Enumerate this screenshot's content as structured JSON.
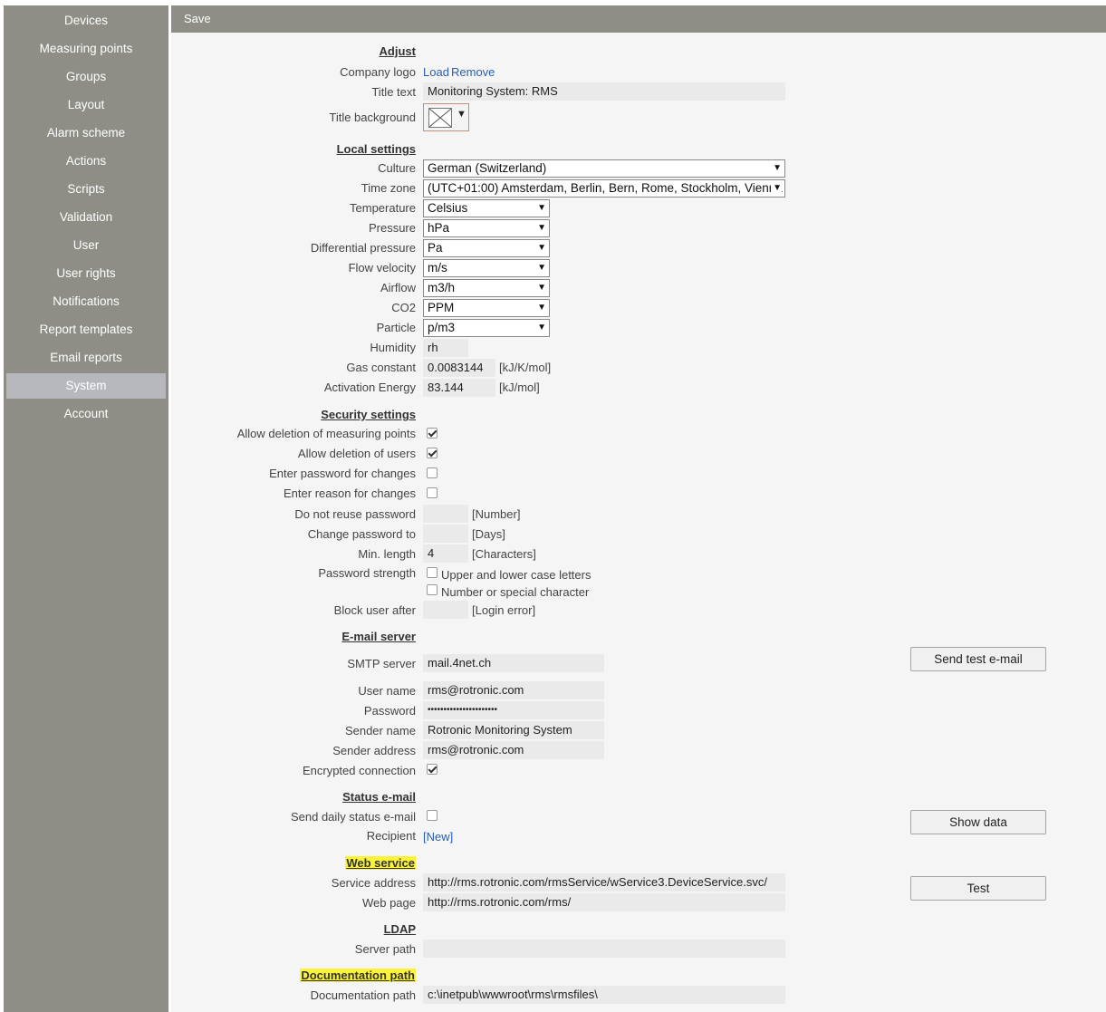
{
  "sidebar": {
    "items": [
      {
        "label": "Devices"
      },
      {
        "label": "Measuring points"
      },
      {
        "label": "Groups"
      },
      {
        "label": "Layout"
      },
      {
        "label": "Alarm scheme"
      },
      {
        "label": "Actions"
      },
      {
        "label": "Scripts"
      },
      {
        "label": "Validation"
      },
      {
        "label": "User"
      },
      {
        "label": "User rights"
      },
      {
        "label": "Notifications"
      },
      {
        "label": "Report templates"
      },
      {
        "label": "Email reports"
      },
      {
        "label": "System"
      },
      {
        "label": "Account"
      }
    ],
    "active": "System"
  },
  "toolbar": {
    "save_label": "Save"
  },
  "adjust": {
    "heading": "Adjust",
    "company_logo_label": "Company logo",
    "load_link": "Load",
    "remove_link": "Remove",
    "title_text_label": "Title text",
    "title_text_value": "Monitoring System: RMS",
    "title_background_label": "Title background"
  },
  "local": {
    "heading": "Local settings",
    "culture_label": "Culture",
    "culture_value": "German (Switzerland)",
    "timezone_label": "Time zone",
    "timezone_value": "(UTC+01:00) Amsterdam, Berlin, Bern, Rome, Stockholm, Vienna",
    "temperature_label": "Temperature",
    "temperature_value": "Celsius",
    "pressure_label": "Pressure",
    "pressure_value": "hPa",
    "diffpressure_label": "Differential pressure",
    "diffpressure_value": "Pa",
    "flowvelocity_label": "Flow velocity",
    "flowvelocity_value": "m/s",
    "airflow_label": "Airflow",
    "airflow_value": "m3/h",
    "co2_label": "CO2",
    "co2_value": "PPM",
    "particle_label": "Particle",
    "particle_value": "p/m3",
    "humidity_label": "Humidity",
    "humidity_value": "rh",
    "gasconstant_label": "Gas constant",
    "gasconstant_value": "0.0083144",
    "gasconstant_unit": "[kJ/K/mol]",
    "activation_label": "Activation Energy",
    "activation_value": "83.144",
    "activation_unit": "[kJ/mol]"
  },
  "security": {
    "heading": "Security settings",
    "allow_del_mp_label": "Allow deletion of measuring points",
    "allow_del_mp_checked": true,
    "allow_del_users_label": "Allow deletion of users",
    "allow_del_users_checked": true,
    "enter_pw_label": "Enter password for changes",
    "enter_pw_checked": false,
    "enter_reason_label": "Enter reason for changes",
    "enter_reason_checked": false,
    "no_reuse_label": "Do not reuse password",
    "no_reuse_value": "",
    "no_reuse_unit": "[Number]",
    "change_pw_label": "Change password to",
    "change_pw_value": "",
    "change_pw_unit": "[Days]",
    "min_len_label": "Min. length",
    "min_len_value": "4",
    "min_len_unit": "[Characters]",
    "strength_label": "Password strength",
    "strength_opt1": "Upper and lower case letters",
    "strength_opt2": "Number or special character",
    "block_label": "Block user after",
    "block_value": "",
    "block_unit": "[Login error]"
  },
  "email": {
    "heading": "E-mail server",
    "smtp_label": "SMTP server",
    "smtp_value": "mail.4net.ch",
    "send_test_button": "Send test e-mail",
    "username_label": "User name",
    "username_value": "rms@rotronic.com",
    "password_label": "Password",
    "password_value": "••••••••••••••••••••••",
    "sendername_label": "Sender name",
    "sendername_value": "Rotronic Monitoring System",
    "senderaddr_label": "Sender address",
    "senderaddr_value": "rms@rotronic.com",
    "encrypted_label": "Encrypted connection",
    "encrypted_checked": true
  },
  "status": {
    "heading": "Status e-mail",
    "daily_label": "Send daily status e-mail",
    "daily_checked": false,
    "recipient_label": "Recipient",
    "new_link": "[New]",
    "show_data_button": "Show data"
  },
  "webservice": {
    "heading": "Web service",
    "service_label": "Service address",
    "service_value": "http://rms.rotronic.com/rmsService/wService3.DeviceService.svc/",
    "webpage_label": "Web page",
    "webpage_value": "http://rms.rotronic.com/rms/",
    "test_button": "Test"
  },
  "ldap": {
    "heading": "LDAP",
    "server_label": "Server path",
    "server_value": ""
  },
  "docpath": {
    "heading": "Documentation path",
    "label": "Documentation path",
    "value": "c:\\inetpub\\wwwroot\\rms\\rmsfiles\\"
  },
  "colors": {
    "sidebar_bg": "#8e8e87",
    "active_item_bg": "#b7b8be",
    "highlight": "#fbf33a",
    "link": "#2a5db0"
  }
}
